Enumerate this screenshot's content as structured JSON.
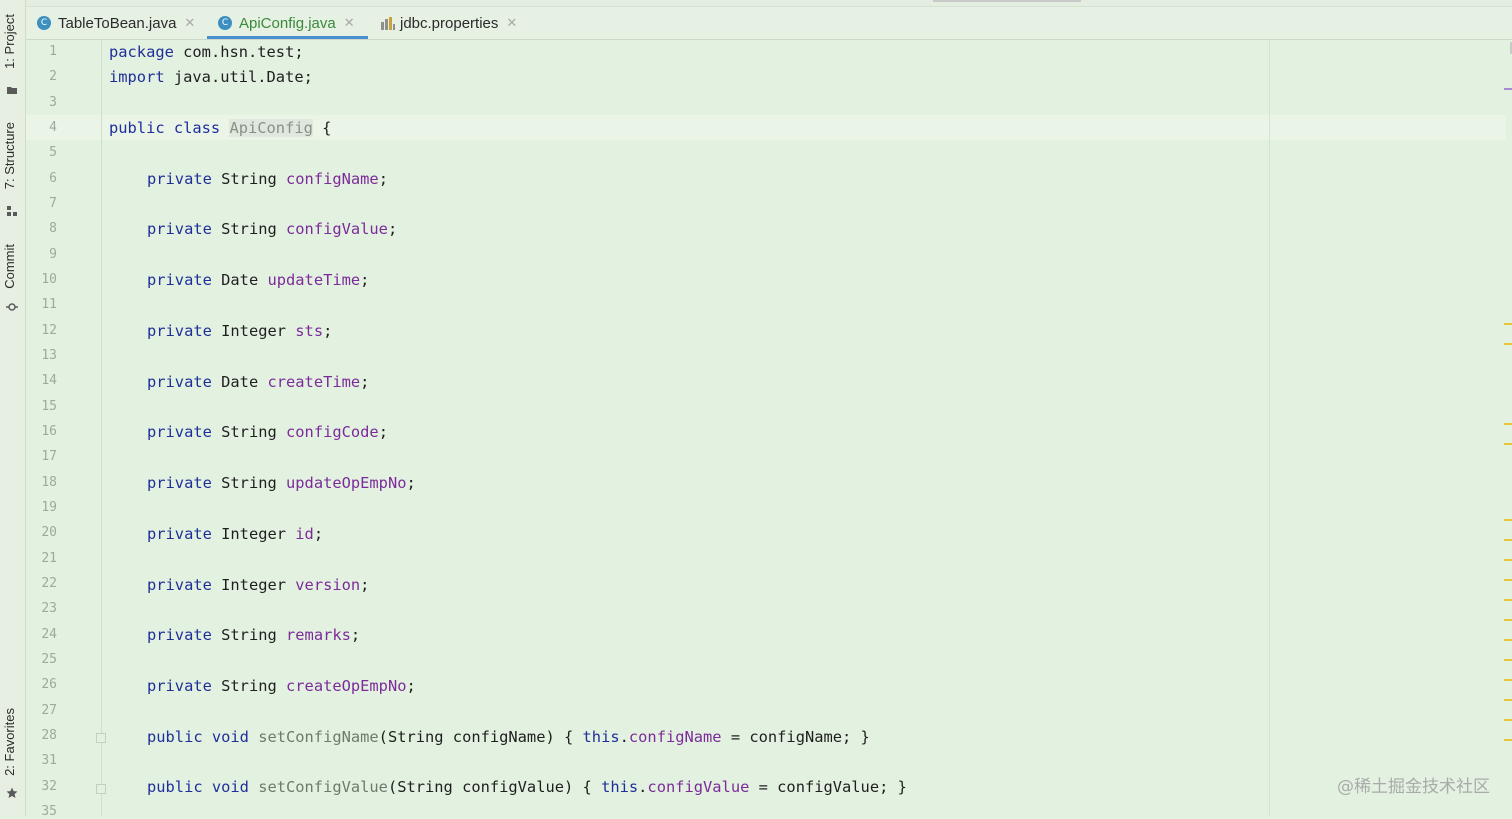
{
  "sidebar": {
    "project": "1: Project",
    "structure": "7: Structure",
    "commit": "Commit",
    "favorites": "2: Favorites"
  },
  "tabs": [
    {
      "label": "TableToBean.java",
      "icon": "class-icon"
    },
    {
      "label": "ApiConfig.java",
      "icon": "class-icon"
    },
    {
      "label": "jdbc.properties",
      "icon": "properties-icon"
    }
  ],
  "line_numbers": [
    "1",
    "2",
    "3",
    "4",
    "5",
    "6",
    "7",
    "8",
    "9",
    "10",
    "11",
    "12",
    "13",
    "14",
    "15",
    "16",
    "17",
    "18",
    "19",
    "20",
    "21",
    "22",
    "23",
    "24",
    "25",
    "26",
    "27",
    "28",
    "31",
    "32",
    "35"
  ],
  "code": {
    "l1_kw": "package",
    "l1_rest": " com.hsn.test;",
    "l2_kw": "import",
    "l2_rest": " java.util.Date;",
    "l4_kw": "public class ",
    "l4_cls": "ApiConfig",
    "l4_rest": " {",
    "private": "private",
    "fields": [
      {
        "type": " String ",
        "name": "configName"
      },
      {
        "type": " String ",
        "name": "configValue"
      },
      {
        "type": " Date ",
        "name": "updateTime"
      },
      {
        "type": " Integer ",
        "name": "sts"
      },
      {
        "type": " Date ",
        "name": "createTime"
      },
      {
        "type": " String ",
        "name": "configCode"
      },
      {
        "type": " String ",
        "name": "updateOpEmpNo"
      },
      {
        "type": " Integer ",
        "name": "id"
      },
      {
        "type": " Integer ",
        "name": "version"
      },
      {
        "type": " String ",
        "name": "remarks"
      },
      {
        "type": " String ",
        "name": "createOpEmpNo"
      }
    ],
    "semicolon": ";",
    "m1": {
      "kw": "public void ",
      "name": "setConfigName",
      "params": "(String configName) { ",
      "this": "this",
      "dot": ".",
      "field": "configName",
      "rest": " = configName; }"
    },
    "m2": {
      "kw": "public void ",
      "name": "setConfigValue",
      "params": "(String configValue) { ",
      "this": "this",
      "dot": ".",
      "field": "configValue",
      "rest": " = configValue; }"
    }
  },
  "watermark": "@稀土掘金技术社区"
}
